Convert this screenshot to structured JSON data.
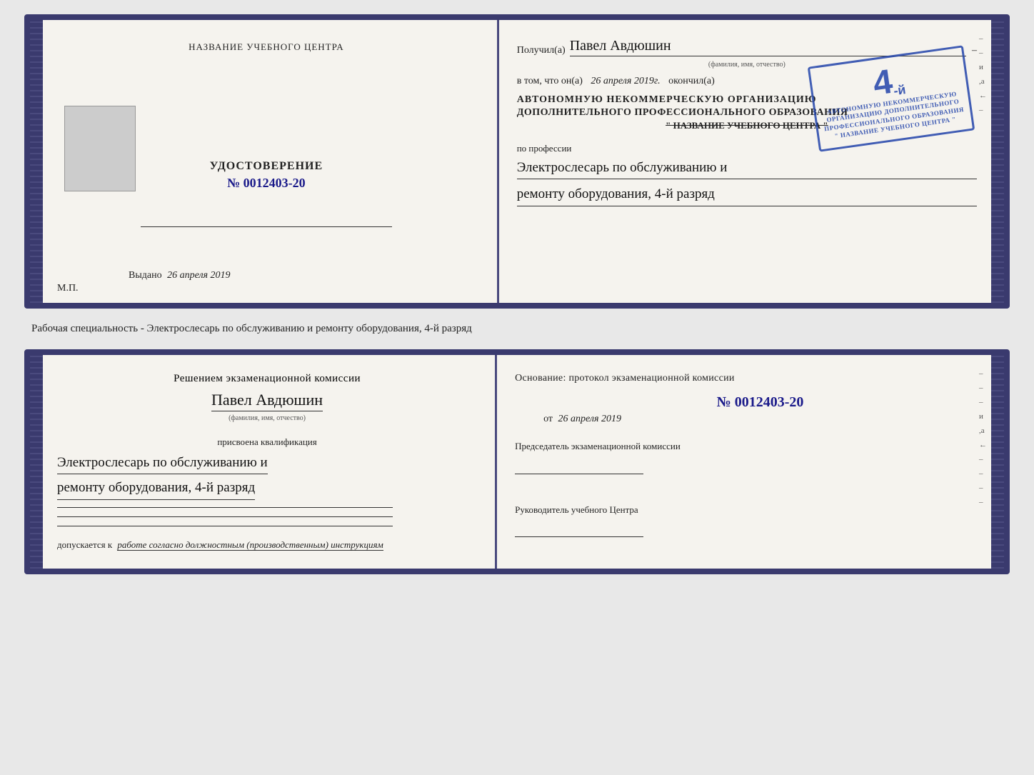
{
  "top_doc": {
    "left": {
      "title": "НАЗВАНИЕ УЧЕБНОГО ЦЕНТРА",
      "photo_alt": "фото",
      "cert_label": "УДОСТОВЕРЕНИЕ",
      "cert_number": "№ 0012403-20",
      "issued_prefix": "Выдано",
      "issued_date": "26 апреля 2019",
      "mp_label": "М.П."
    },
    "right": {
      "received_prefix": "Получил(а)",
      "recipient_name": "Павел Авдюшин",
      "fio_label": "(фамилия, имя, отчество)",
      "vtom_prefix": "в том, что он(а)",
      "vtom_date": "26 апреля 2019г.",
      "okonchil": "окончил(а)",
      "org_line1": "АВТОНОМНУЮ НЕКОММЕРЧЕСКУЮ ОРГАНИЗАЦИЮ",
      "org_line2": "ДОПОЛНИТЕЛЬНОГО ПРОФЕССИОНАЛЬНОГО ОБРАЗОВАНИЯ",
      "org_line3": "\" НАЗВАНИЕ УЧЕБНОГО ЦЕНТРА \"",
      "po_professii": "по профессии",
      "profession_line1": "Электрослесарь по обслуживанию и",
      "profession_line2": "ремонту оборудования, 4-й разряд",
      "stamp_grade": "4",
      "stamp_suffix": "-й",
      "stamp_text_line1": "АВТОНОМНУЮ НЕКОММЕРЧЕСКУЮ",
      "stamp_text_line2": "ОРГАНИЗАЦИЮ ДОПОЛНИТЕЛЬНОГО",
      "stamp_text_line3": "ПРОФЕССИОНАЛЬНОГО ОБРАЗОВАНИЯ",
      "stamp_text_line4": "\" НАЗВАНИЕ УЧЕБНОГО ЦЕНТРА \""
    }
  },
  "middle_text": "Рабочая специальность - Электрослесарь по обслуживанию и ремонту оборудования, 4-й разряд",
  "bottom_doc": {
    "left": {
      "commission_title": "Решением экзаменационной комиссии",
      "person_name": "Павел Авдюшин",
      "fio_label": "(фамилия, имя, отчество)",
      "prisvoena": "присвоена квалификация",
      "qual_line1": "Электрослесарь по обслуживанию и",
      "qual_line2": "ремонту оборудования, 4-й разряд",
      "dopuskaetsya": "допускается к",
      "dopusk_text": "работе согласно должностным (производственным) инструкциям"
    },
    "right": {
      "osnov_label": "Основание: протокол экзаменационной комиссии",
      "proto_number": "№ 0012403-20",
      "ot_prefix": "от",
      "proto_date": "26 апреля 2019",
      "chair_title": "Председатель экзаменационной комиссии",
      "rukov_title": "Руководитель учебного Центра"
    },
    "side": {
      "marks": [
        "–",
        "–",
        "–",
        "и",
        ",а",
        "←",
        "–",
        "–",
        "–",
        "–"
      ]
    }
  }
}
